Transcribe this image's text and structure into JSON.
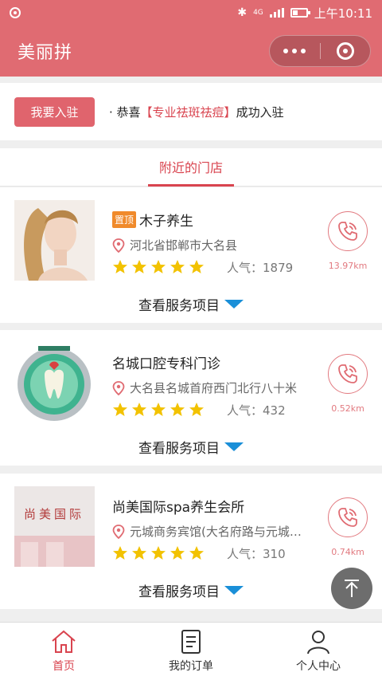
{
  "status_bar": {
    "time": "上午10:11",
    "network": "4G"
  },
  "header": {
    "title": "美丽拼"
  },
  "notice": {
    "join_label": "我要入驻",
    "prefix": "· 恭喜",
    "highlight": "【专业祛斑祛痘】",
    "suffix": "成功入驻"
  },
  "section": {
    "tab_label": "附近的门店"
  },
  "stores": [
    {
      "pinned_tag": "置顶",
      "name": "木子养生",
      "address": "河北省邯郸市大名县",
      "rating": 5,
      "popularity": "人气：1879",
      "distance": "13.97km",
      "service_label": "查看服务项目"
    },
    {
      "name": "名城口腔专科门诊",
      "address": "大名县名城首府西门北行八十米",
      "rating": 5,
      "popularity": "人气：432",
      "distance": "0.52km",
      "service_label": "查看服务项目"
    },
    {
      "name": "尚美国际spa养生会所",
      "address": "元城商务宾馆(大名府路与元城…",
      "rating": 5,
      "popularity": "人气：310",
      "distance": "0.74km",
      "service_label": "查看服务项目",
      "thumb_sign": "尚美国际"
    }
  ],
  "tabbar": {
    "items": [
      {
        "label": "首页",
        "icon": "home-icon",
        "active": true
      },
      {
        "label": "我的订单",
        "icon": "order-icon",
        "active": false
      },
      {
        "label": "个人中心",
        "icon": "user-icon",
        "active": false
      }
    ]
  },
  "colors": {
    "brand": "#e06b72",
    "accent_red": "#d9444f",
    "star": "#f2c200",
    "arrow_blue": "#1a8fd8",
    "pin_tag": "#f08a2b"
  }
}
